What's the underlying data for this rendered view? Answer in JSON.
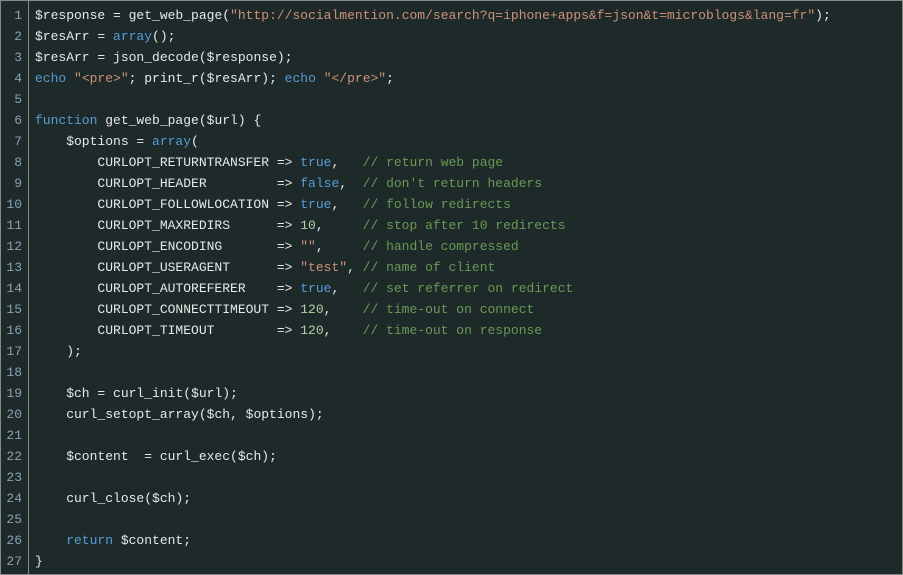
{
  "language": "php",
  "theme": "dark",
  "colors": {
    "background": "#1e2a2a",
    "gutter_border": "#888888",
    "line_number": "#8aa0b4",
    "default": "#e8e8e8",
    "keyword": "#569cd6",
    "string": "#ce9178",
    "number": "#b5cea8",
    "comment": "#6a9955"
  },
  "line_numbers": [
    "1",
    "2",
    "3",
    "4",
    "5",
    "6",
    "7",
    "8",
    "9",
    "10",
    "11",
    "12",
    "13",
    "14",
    "15",
    "16",
    "17",
    "18",
    "19",
    "20",
    "21",
    "22",
    "23",
    "24",
    "25",
    "26",
    "27"
  ],
  "lines": [
    [
      {
        "t": "$response ",
        "c": "tok-var"
      },
      {
        "t": "= ",
        "c": "tok-op"
      },
      {
        "t": "get_web_page",
        "c": "tok-func"
      },
      {
        "t": "(",
        "c": "tok-punc"
      },
      {
        "t": "\"http://socialmention.com/search?q=iphone+apps&f=json&t=microblogs&lang=fr\"",
        "c": "tok-str"
      },
      {
        "t": ");",
        "c": "tok-punc"
      }
    ],
    [
      {
        "t": "$resArr ",
        "c": "tok-var"
      },
      {
        "t": "= ",
        "c": "tok-op"
      },
      {
        "t": "array",
        "c": "tok-kw"
      },
      {
        "t": "();",
        "c": "tok-punc"
      }
    ],
    [
      {
        "t": "$resArr ",
        "c": "tok-var"
      },
      {
        "t": "= ",
        "c": "tok-op"
      },
      {
        "t": "json_decode",
        "c": "tok-func"
      },
      {
        "t": "(",
        "c": "tok-punc"
      },
      {
        "t": "$response",
        "c": "tok-var"
      },
      {
        "t": ");",
        "c": "tok-punc"
      }
    ],
    [
      {
        "t": "echo ",
        "c": "tok-kw"
      },
      {
        "t": "\"<pre>\"",
        "c": "tok-str"
      },
      {
        "t": "; ",
        "c": "tok-punc"
      },
      {
        "t": "print_r",
        "c": "tok-func"
      },
      {
        "t": "(",
        "c": "tok-punc"
      },
      {
        "t": "$resArr",
        "c": "tok-var"
      },
      {
        "t": "); ",
        "c": "tok-punc"
      },
      {
        "t": "echo ",
        "c": "tok-kw"
      },
      {
        "t": "\"</pre>\"",
        "c": "tok-str"
      },
      {
        "t": ";",
        "c": "tok-punc"
      }
    ],
    [
      {
        "t": " ",
        "c": "tok-punc"
      }
    ],
    [
      {
        "t": "function ",
        "c": "tok-kw"
      },
      {
        "t": "get_web_page",
        "c": "tok-func"
      },
      {
        "t": "(",
        "c": "tok-punc"
      },
      {
        "t": "$url",
        "c": "tok-var"
      },
      {
        "t": ") {",
        "c": "tok-punc"
      }
    ],
    [
      {
        "t": "    $options ",
        "c": "tok-var"
      },
      {
        "t": "= ",
        "c": "tok-op"
      },
      {
        "t": "array",
        "c": "tok-kw"
      },
      {
        "t": "(",
        "c": "tok-punc"
      }
    ],
    [
      {
        "t": "        CURLOPT_RETURNTRANSFER ",
        "c": "tok-ident"
      },
      {
        "t": "=> ",
        "c": "tok-op"
      },
      {
        "t": "true",
        "c": "tok-bool"
      },
      {
        "t": ",   ",
        "c": "tok-punc"
      },
      {
        "t": "// return web page",
        "c": "tok-comment"
      }
    ],
    [
      {
        "t": "        CURLOPT_HEADER         ",
        "c": "tok-ident"
      },
      {
        "t": "=> ",
        "c": "tok-op"
      },
      {
        "t": "false",
        "c": "tok-bool"
      },
      {
        "t": ",  ",
        "c": "tok-punc"
      },
      {
        "t": "// don't return headers",
        "c": "tok-comment"
      }
    ],
    [
      {
        "t": "        CURLOPT_FOLLOWLOCATION ",
        "c": "tok-ident"
      },
      {
        "t": "=> ",
        "c": "tok-op"
      },
      {
        "t": "true",
        "c": "tok-bool"
      },
      {
        "t": ",   ",
        "c": "tok-punc"
      },
      {
        "t": "// follow redirects",
        "c": "tok-comment"
      }
    ],
    [
      {
        "t": "        CURLOPT_MAXREDIRS      ",
        "c": "tok-ident"
      },
      {
        "t": "=> ",
        "c": "tok-op"
      },
      {
        "t": "10",
        "c": "tok-num"
      },
      {
        "t": ",     ",
        "c": "tok-punc"
      },
      {
        "t": "// stop after 10 redirects",
        "c": "tok-comment"
      }
    ],
    [
      {
        "t": "        CURLOPT_ENCODING       ",
        "c": "tok-ident"
      },
      {
        "t": "=> ",
        "c": "tok-op"
      },
      {
        "t": "\"\"",
        "c": "tok-str"
      },
      {
        "t": ",     ",
        "c": "tok-punc"
      },
      {
        "t": "// handle compressed",
        "c": "tok-comment"
      }
    ],
    [
      {
        "t": "        CURLOPT_USERAGENT      ",
        "c": "tok-ident"
      },
      {
        "t": "=> ",
        "c": "tok-op"
      },
      {
        "t": "\"test\"",
        "c": "tok-str"
      },
      {
        "t": ", ",
        "c": "tok-punc"
      },
      {
        "t": "// name of client",
        "c": "tok-comment"
      }
    ],
    [
      {
        "t": "        CURLOPT_AUTOREFERER    ",
        "c": "tok-ident"
      },
      {
        "t": "=> ",
        "c": "tok-op"
      },
      {
        "t": "true",
        "c": "tok-bool"
      },
      {
        "t": ",   ",
        "c": "tok-punc"
      },
      {
        "t": "// set referrer on redirect",
        "c": "tok-comment"
      }
    ],
    [
      {
        "t": "        CURLOPT_CONNECTTIMEOUT ",
        "c": "tok-ident"
      },
      {
        "t": "=> ",
        "c": "tok-op"
      },
      {
        "t": "120",
        "c": "tok-num"
      },
      {
        "t": ",    ",
        "c": "tok-punc"
      },
      {
        "t": "// time-out on connect",
        "c": "tok-comment"
      }
    ],
    [
      {
        "t": "        CURLOPT_TIMEOUT        ",
        "c": "tok-ident"
      },
      {
        "t": "=> ",
        "c": "tok-op"
      },
      {
        "t": "120",
        "c": "tok-num"
      },
      {
        "t": ",    ",
        "c": "tok-punc"
      },
      {
        "t": "// time-out on response",
        "c": "tok-comment"
      }
    ],
    [
      {
        "t": "    );",
        "c": "tok-punc"
      }
    ],
    [
      {
        "t": " ",
        "c": "tok-punc"
      }
    ],
    [
      {
        "t": "    $ch ",
        "c": "tok-var"
      },
      {
        "t": "= ",
        "c": "tok-op"
      },
      {
        "t": "curl_init",
        "c": "tok-func"
      },
      {
        "t": "(",
        "c": "tok-punc"
      },
      {
        "t": "$url",
        "c": "tok-var"
      },
      {
        "t": ");",
        "c": "tok-punc"
      }
    ],
    [
      {
        "t": "    curl_setopt_array",
        "c": "tok-func"
      },
      {
        "t": "(",
        "c": "tok-punc"
      },
      {
        "t": "$ch",
        "c": "tok-var"
      },
      {
        "t": ", ",
        "c": "tok-punc"
      },
      {
        "t": "$options",
        "c": "tok-var"
      },
      {
        "t": ");",
        "c": "tok-punc"
      }
    ],
    [
      {
        "t": " ",
        "c": "tok-punc"
      }
    ],
    [
      {
        "t": "    $content  ",
        "c": "tok-var"
      },
      {
        "t": "= ",
        "c": "tok-op"
      },
      {
        "t": "curl_exec",
        "c": "tok-func"
      },
      {
        "t": "(",
        "c": "tok-punc"
      },
      {
        "t": "$ch",
        "c": "tok-var"
      },
      {
        "t": ");",
        "c": "tok-punc"
      }
    ],
    [
      {
        "t": " ",
        "c": "tok-punc"
      }
    ],
    [
      {
        "t": "    curl_close",
        "c": "tok-func"
      },
      {
        "t": "(",
        "c": "tok-punc"
      },
      {
        "t": "$ch",
        "c": "tok-var"
      },
      {
        "t": ");",
        "c": "tok-punc"
      }
    ],
    [
      {
        "t": " ",
        "c": "tok-punc"
      }
    ],
    [
      {
        "t": "    return ",
        "c": "tok-kw"
      },
      {
        "t": "$content",
        "c": "tok-var"
      },
      {
        "t": ";",
        "c": "tok-punc"
      }
    ],
    [
      {
        "t": "}",
        "c": "tok-punc"
      }
    ]
  ]
}
